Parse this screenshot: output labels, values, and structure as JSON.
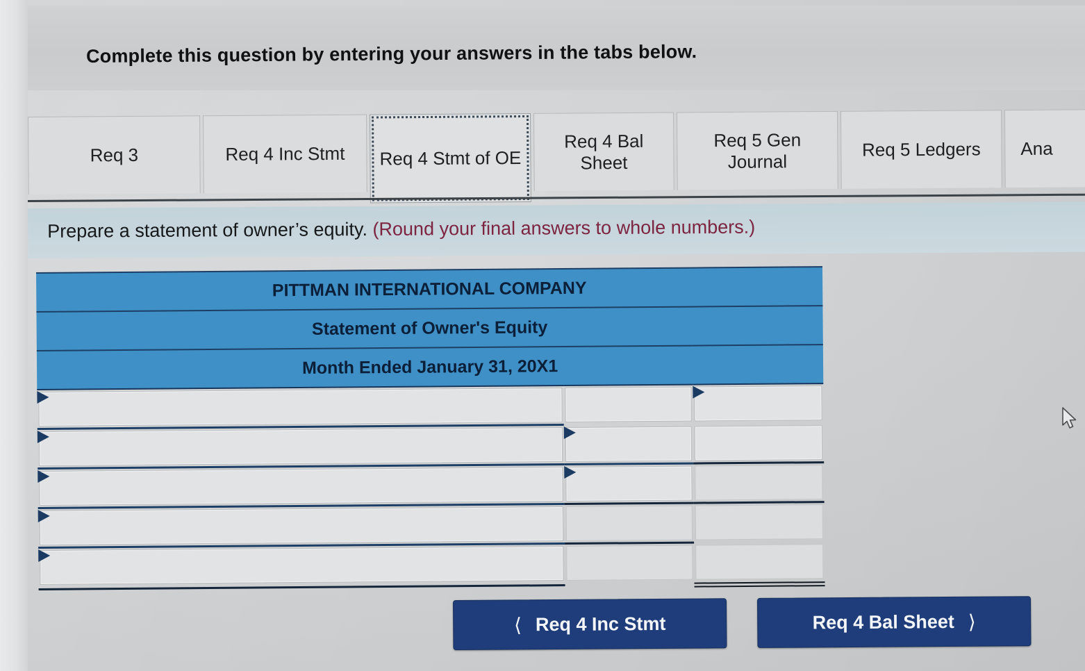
{
  "banner": {
    "text": "Complete this question by entering your answers in the tabs below."
  },
  "tabs": {
    "items": [
      {
        "label": "Req 3",
        "active": false
      },
      {
        "label": "Req 4 Inc Stmt",
        "active": false
      },
      {
        "label": "Req 4 Stmt of OE",
        "active": true
      },
      {
        "label": "Req 4 Bal Sheet",
        "active": false
      },
      {
        "label": "Req 5 Gen Journal",
        "active": false
      },
      {
        "label": "Req 5 Ledgers",
        "active": false
      },
      {
        "label": "Ana",
        "active": false
      }
    ]
  },
  "prompt": {
    "main": "Prepare a statement of owner’s equity.",
    "round_note": "(Round your final answers to whole numbers.)",
    "round_color": "#7d2440"
  },
  "statement": {
    "header_bg": "#3f90c6",
    "title_lines": [
      "PITTMAN INTERNATIONAL COMPANY",
      "Statement of Owner's Equity",
      "Month Ended January 31, 20X1"
    ],
    "columns": [
      "description",
      "amount_1",
      "amount_2"
    ],
    "rows": [
      {
        "description": "",
        "amount_1": "",
        "amount_2": "",
        "desc_select": true,
        "amt1_select": false,
        "amt2_select": true
      },
      {
        "description": "",
        "amount_1": "",
        "amount_2": "",
        "desc_select": true,
        "amt1_select": true,
        "amt2_select": false
      },
      {
        "description": "",
        "amount_1": "",
        "amount_2": "",
        "desc_select": true,
        "amt1_select": true,
        "amt2_select": false
      },
      {
        "description": "",
        "amount_1": "",
        "amount_2": "",
        "desc_select": true,
        "amt1_select": false,
        "amt2_select": false
      },
      {
        "description": "",
        "amount_1": "",
        "amount_2": "",
        "desc_select": true,
        "amt1_select": false,
        "amt2_select": false
      }
    ]
  },
  "nav": {
    "prev_label": "Req 4 Inc Stmt",
    "prev_icon": "chevron-left-icon",
    "next_label": "Req 4 Bal Sheet",
    "next_icon": "chevron-right-icon",
    "button_color": "#1f3d7a"
  }
}
